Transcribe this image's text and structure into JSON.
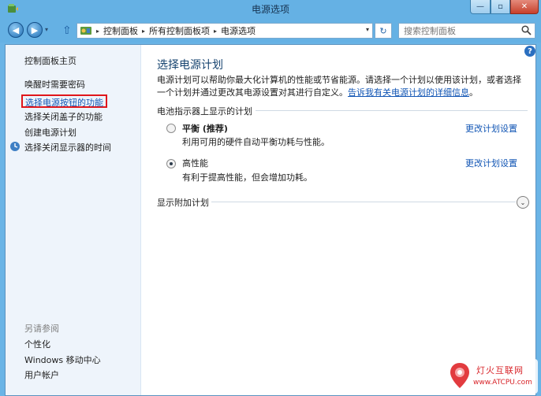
{
  "window": {
    "title": "电源选项",
    "buttons": {
      "minimize": "—",
      "maximize": "▫",
      "close": "✕"
    }
  },
  "address_bar": {
    "breadcrumbs": [
      "控制面板",
      "所有控制面板项",
      "电源选项"
    ],
    "separator": "▸",
    "dropdown": "▾",
    "refresh": "↻",
    "search_placeholder": "搜索控制面板"
  },
  "sidebar": {
    "home": "控制面板主页",
    "links": [
      "唤醒时需要密码",
      "选择电源按钮的功能",
      "选择关闭盖子的功能",
      "创建电源计划",
      "选择关闭显示器的时间"
    ],
    "see_also_title": "另请参阅",
    "see_also": [
      "个性化",
      "Windows 移动中心",
      "用户帐户"
    ]
  },
  "main": {
    "help": "?",
    "title": "选择电源计划",
    "description": "电源计划可以帮助你最大化计算机的性能或节省能源。请选择一个计划以使用该计划，或者选择一个计划并通过更改其电源设置对其进行自定义。",
    "description_link": "告诉我有关电源计划的详细信息",
    "section_battery": "电池指示器上显示的计划",
    "plans": [
      {
        "name": "平衡 (推荐)",
        "description": "利用可用的硬件自动平衡功耗与性能。",
        "link": "更改计划设置",
        "selected": false
      },
      {
        "name": "高性能",
        "description": "有利于提高性能，但会增加功耗。",
        "link": "更改计划设置",
        "selected": true
      }
    ],
    "section_more": "显示附加计划",
    "expand": "⌄"
  },
  "watermark": {
    "name": "灯火互联网",
    "url": "www.ATCPU.com"
  },
  "colors": {
    "accent": "#65b1e4",
    "link": "#1155b4",
    "highlight_border": "#e0161b"
  }
}
